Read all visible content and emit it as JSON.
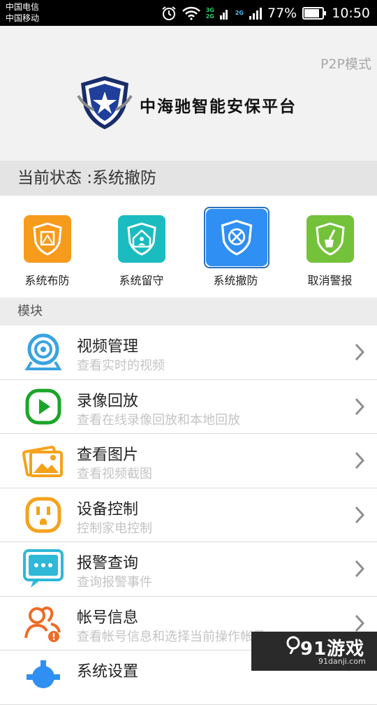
{
  "statusbar": {
    "carrier1": "中国电信",
    "carrier2": "中国移动",
    "network_labels": [
      "3G",
      "2G",
      "2G"
    ],
    "battery": "77%",
    "time": "10:50"
  },
  "header": {
    "mode": "P2P模式",
    "brand": "中海驰智能安保平台"
  },
  "state": {
    "label": "当前状态 :系统撤防"
  },
  "actions": [
    {
      "label": "系统布防",
      "color": "#f79b1c",
      "icon": "arm-shield-icon"
    },
    {
      "label": "系统留守",
      "color": "#1bbcc0",
      "icon": "home-stay-icon"
    },
    {
      "label": "系统撤防",
      "color": "#2f8ff2",
      "icon": "disarm-shield-icon",
      "selected": true
    },
    {
      "label": "取消警报",
      "color": "#73c23a",
      "icon": "cancel-alarm-icon"
    }
  ],
  "modules": {
    "header": "模块",
    "items": [
      {
        "title": "视频管理",
        "subtitle": "查看实时的视频",
        "icon": "camera-icon"
      },
      {
        "title": "录像回放",
        "subtitle": "查看在线录像回放和本地回放",
        "icon": "play-icon"
      },
      {
        "title": "查看图片",
        "subtitle": "查看视频截图",
        "icon": "pictures-icon"
      },
      {
        "title": "设备控制",
        "subtitle": "控制家电控制",
        "icon": "socket-icon"
      },
      {
        "title": "报警查询",
        "subtitle": "查询报警事件",
        "icon": "message-icon"
      },
      {
        "title": "帐号信息",
        "subtitle": "查看帐号信息和选择当前操作帐号",
        "icon": "account-icon"
      },
      {
        "title": "系统设置",
        "subtitle": "",
        "icon": "settings-icon"
      }
    ]
  },
  "watermark": {
    "text": "91游戏",
    "url": "91danji.com"
  }
}
